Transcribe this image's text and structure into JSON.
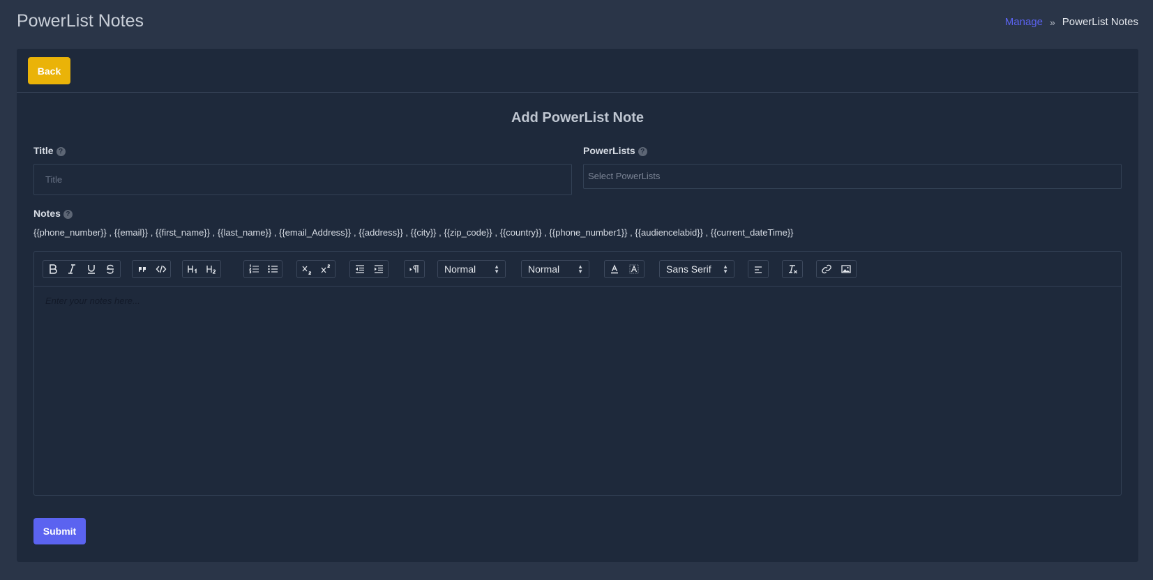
{
  "page": {
    "title": "PowerList Notes"
  },
  "breadcrumb": {
    "link": "Manage",
    "separator": "»",
    "current": "PowerList Notes"
  },
  "card": {
    "back_label": "Back",
    "heading": "Add PowerList Note",
    "title_field": {
      "label": "Title",
      "placeholder": "Title",
      "value": ""
    },
    "powerlists_field": {
      "label": "PowerLists",
      "placeholder": "Select PowerLists"
    },
    "notes_field": {
      "label": "Notes",
      "placeholders": "{{phone_number}} , {{email}} , {{first_name}} , {{last_name}} , {{email_Address}} , {{address}} , {{city}} , {{zip_code}} , {{country}} , {{phone_number1}} , {{audiencelabid}} , {{current_dateTime}}"
    },
    "editor": {
      "placeholder": "Enter your notes here...",
      "header_select": "Normal",
      "size_select": "Normal",
      "font_select": "Sans Serif"
    },
    "submit_label": "Submit"
  },
  "colors": {
    "background": "#2a3548",
    "card": "#1e293b",
    "primary": "#5b63f0",
    "warning": "#eab308"
  },
  "help_icon_glyph": "?"
}
